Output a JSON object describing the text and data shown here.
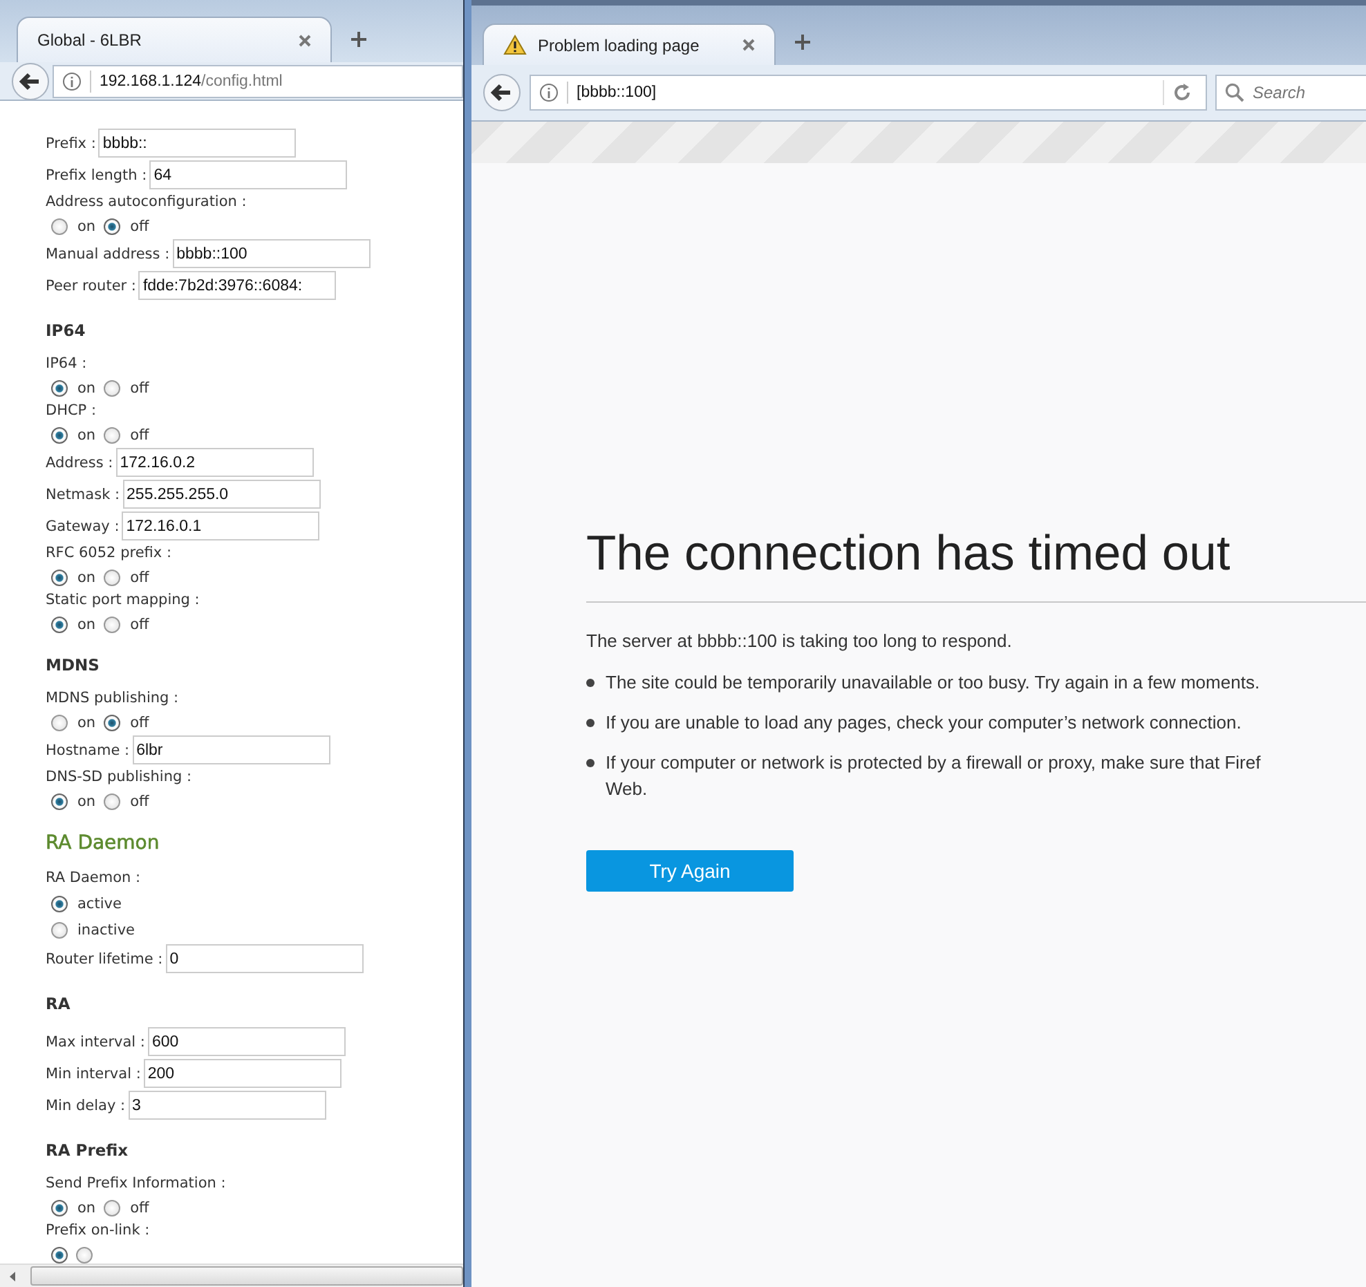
{
  "left_window": {
    "tab_title": "Global - 6LBR",
    "url_host": "192.168.1.124",
    "url_path": "/config.html",
    "sections": [
      {
        "items": [
          {
            "kind": "field",
            "label": "Prefix :",
            "value": "bbbb::"
          },
          {
            "kind": "field",
            "label": "Prefix length :",
            "value": "64"
          },
          {
            "kind": "radio",
            "label": "Address autoconfiguration :",
            "options": [
              {
                "label": "on",
                "selected": false
              },
              {
                "label": "off",
                "selected": true
              }
            ]
          },
          {
            "kind": "field",
            "label": "Manual address :",
            "value": "bbbb::100"
          },
          {
            "kind": "field",
            "label": "Peer router :",
            "value": "fdde:7b2d:3976::6084:"
          }
        ]
      },
      {
        "heading": "IP64",
        "kind": "plain",
        "items": [
          {
            "kind": "radio",
            "label": "IP64 :",
            "options": [
              {
                "label": "on",
                "selected": true
              },
              {
                "label": "off",
                "selected": false
              }
            ]
          },
          {
            "kind": "radio",
            "label": "DHCP :",
            "options": [
              {
                "label": "on",
                "selected": true
              },
              {
                "label": "off",
                "selected": false
              }
            ]
          },
          {
            "kind": "field",
            "label": "Address :",
            "value": "172.16.0.2"
          },
          {
            "kind": "field",
            "label": "Netmask :",
            "value": "255.255.255.0"
          },
          {
            "kind": "field",
            "label": "Gateway :",
            "value": "172.16.0.1"
          },
          {
            "kind": "radio",
            "label": "RFC 6052 prefix :",
            "options": [
              {
                "label": "on",
                "selected": true
              },
              {
                "label": "off",
                "selected": false
              }
            ]
          },
          {
            "kind": "radio",
            "label": "Static port mapping :",
            "options": [
              {
                "label": "on",
                "selected": true
              },
              {
                "label": "off",
                "selected": false
              }
            ]
          }
        ]
      },
      {
        "heading": "MDNS",
        "kind": "plain",
        "items": [
          {
            "kind": "radio",
            "label": "MDNS publishing :",
            "options": [
              {
                "label": "on",
                "selected": false
              },
              {
                "label": "off",
                "selected": true
              }
            ]
          },
          {
            "kind": "field",
            "label": "Hostname :",
            "value": "6lbr"
          },
          {
            "kind": "radio",
            "label": "DNS-SD publishing :",
            "options": [
              {
                "label": "on",
                "selected": true
              },
              {
                "label": "off",
                "selected": false
              }
            ]
          }
        ]
      },
      {
        "heading": "RA Daemon",
        "kind": "accent",
        "items": [
          {
            "kind": "radio_stacked",
            "label": "RA Daemon :",
            "options": [
              {
                "label": "active",
                "selected": true
              },
              {
                "label": "inactive",
                "selected": false
              }
            ]
          },
          {
            "kind": "field",
            "label": "Router lifetime :",
            "value": "0"
          }
        ]
      },
      {
        "heading": "RA",
        "kind": "plain",
        "items": [
          {
            "kind": "field",
            "label": "Max interval :",
            "value": "600"
          },
          {
            "kind": "field",
            "label": "Min interval :",
            "value": "200"
          },
          {
            "kind": "field",
            "label": "Min delay :",
            "value": "3"
          }
        ]
      },
      {
        "heading": "RA Prefix",
        "kind": "plain",
        "items": [
          {
            "kind": "radio",
            "label": "Send Prefix Information :",
            "options": [
              {
                "label": "on",
                "selected": true
              },
              {
                "label": "off",
                "selected": false
              }
            ]
          },
          {
            "kind": "radio",
            "label": "Prefix on-link :",
            "options": [
              {
                "selected": true
              },
              {
                "selected": false
              }
            ]
          }
        ]
      }
    ]
  },
  "right_window": {
    "tab_title": "Problem loading page",
    "url": "[bbbb::100]",
    "search": {
      "placeholder": "Search"
    },
    "title": "The connection has timed out",
    "message": "The server at bbbb::100 is taking too long to respond.",
    "bullets": [
      [
        "The site could be temporarily unavailable or too busy. Try again in a few moments."
      ],
      [
        "If you are unable to load any pages, check your computer’s network connection."
      ],
      [
        "If your computer or network is protected by a firewall or proxy, make sure that Firef",
        "Web."
      ]
    ],
    "button": "Try Again"
  }
}
